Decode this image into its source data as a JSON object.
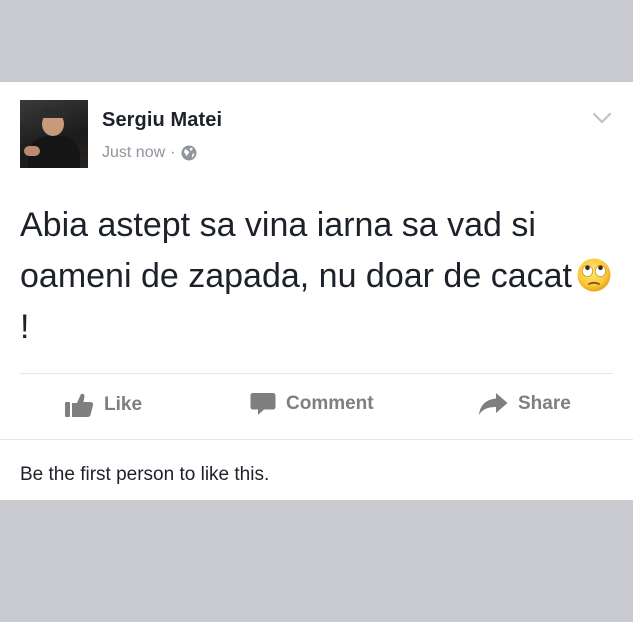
{
  "post": {
    "author_name": "Sergiu Matei",
    "timestamp": "Just now",
    "separator": "·",
    "privacy_icon": "globe-icon",
    "menu_icon": "chevron-down-icon",
    "text_before_emoji": "Abia astept sa vina iarna sa vad si oameni de zapada, nu doar de cacat",
    "emoji_icon": "eye-roll-emoji",
    "text_after_emoji": "!"
  },
  "actions": {
    "like_label": "Like",
    "comment_label": "Comment",
    "share_label": "Share"
  },
  "footer": {
    "likes_text": "Be the first person to like this."
  },
  "colors": {
    "page_background": "#c9cacf",
    "card_background": "#ffffff",
    "text_primary": "#1d2129",
    "text_secondary": "#90949c",
    "action_gray": "#7f7f7f",
    "divider": "#e5e6e9"
  }
}
